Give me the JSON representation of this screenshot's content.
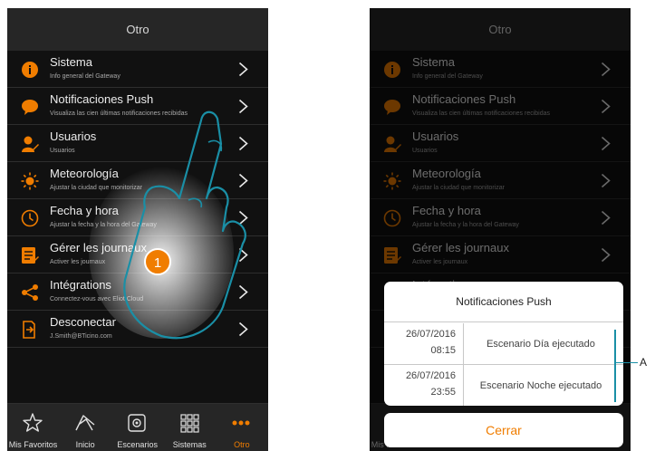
{
  "header_title": "Otro",
  "menu": [
    {
      "title": "Sistema",
      "subtitle": "Info general del Gateway",
      "icon": "info-icon"
    },
    {
      "title": "Notificaciones Push",
      "subtitle": "Visualiza las cien últimas notificaciones recibidas",
      "icon": "speech-bubble-icon"
    },
    {
      "title": "Usuarios",
      "subtitle": "Usuarios",
      "icon": "user-edit-icon"
    },
    {
      "title": "Meteorología",
      "subtitle": "Ajustar la ciudad que monitorizar",
      "icon": "sun-icon"
    },
    {
      "title": "Fecha y hora",
      "subtitle": "Ajustar la fecha y la hora del Gateway",
      "icon": "clock-icon"
    },
    {
      "title": "Gérer les journaux",
      "subtitle": "Activer les journaux",
      "icon": "log-book-icon"
    },
    {
      "title": "Intégrations",
      "subtitle": "Connectez-vous avec Eliot Cloud",
      "icon": "share-icon"
    },
    {
      "title": "Desconectar",
      "subtitle": "J.Smith@BTicino.com",
      "icon": "logout-icon"
    }
  ],
  "tabs": [
    {
      "label": "Mis Favoritos",
      "icon": "star-icon"
    },
    {
      "label": "Inicio",
      "icon": "home-icon"
    },
    {
      "label": "Escenarios",
      "icon": "scenario-icon"
    },
    {
      "label": "Sistemas",
      "icon": "grid-icon"
    },
    {
      "label": "Otro",
      "icon": "more-dots-icon"
    }
  ],
  "step_number": "1",
  "dialog": {
    "title": "Notificaciones Push",
    "rows": [
      {
        "date": "26/07/2016",
        "time": "08:15",
        "text": "Escenario Día ejecutado"
      },
      {
        "date": "26/07/2016",
        "time": "23:55",
        "text": "Escenario Noche ejecutado"
      }
    ],
    "close_label": "Cerrar"
  },
  "callout_letter": "A",
  "colors": {
    "accent": "#f07d00",
    "background": "#111111",
    "header": "#262626",
    "callout": "#1a8fa6"
  }
}
